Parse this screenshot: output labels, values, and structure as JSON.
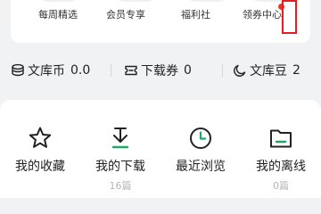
{
  "services": [
    {
      "label": "每周精选",
      "icon": "weekly-picks-icon"
    },
    {
      "label": "会员专享",
      "icon": "member-exclusive-icon"
    },
    {
      "label": "福利社",
      "icon": "welfare-icon"
    },
    {
      "label": "领券中心",
      "icon": "coupon-center-icon"
    }
  ],
  "assets": [
    {
      "label": "文库币",
      "value": "0.0",
      "icon": "coin-stack-icon"
    },
    {
      "label": "下载券",
      "value": "0",
      "icon": "download-ticket-icon"
    },
    {
      "label": "文库豆",
      "value": "2",
      "icon": "bean-icon"
    }
  ],
  "nav": [
    {
      "label": "我的收藏",
      "sub": "",
      "icon": "star-icon"
    },
    {
      "label": "我的下载",
      "sub": "16篇",
      "icon": "download-icon"
    },
    {
      "label": "最近浏览",
      "sub": "",
      "icon": "clock-icon"
    },
    {
      "label": "我的离线",
      "sub": "0篇",
      "icon": "offline-folder-icon"
    }
  ],
  "colors": {
    "accent_green": "#1fa868",
    "highlight_red": "#e02020",
    "page_background": "#f1f2f4"
  }
}
